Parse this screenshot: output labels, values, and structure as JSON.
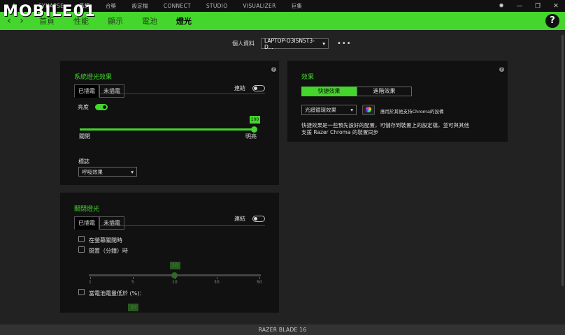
{
  "watermark": "MOBILE01",
  "topnav": [
    "SYNAPSE",
    "系統",
    "合獎",
    "設定檔",
    "CONNECT",
    "STUDIO",
    "VISUALIZER",
    "巨集"
  ],
  "subnav": [
    "首頁",
    "性能",
    "顯示",
    "電池",
    "燈光"
  ],
  "profile": {
    "label": "個人資料",
    "value": "LAPTOP-O3ISN5T3-D..."
  },
  "system_lighting": {
    "title": "系統燈光效果",
    "tabs": [
      "已插電",
      "未插電"
    ],
    "sync_label": "連結",
    "brightness_label": "亮度",
    "brightness_value": 100,
    "min_label": "關閉",
    "max_label": "明亮",
    "logo_label": "標誌",
    "logo_effect": "呼吸效果"
  },
  "lighting_off": {
    "title": "關閉燈光",
    "tabs": [
      "已插電",
      "未插電"
    ],
    "sync_label": "連結",
    "option_screen_off": "在螢幕關閉時",
    "option_idle": "閒置（分鐘）時",
    "idle_value": "10",
    "idle_ticks": [
      "1",
      "5",
      "10",
      "30",
      "50"
    ],
    "option_battery": "當電池電量低於 (%)：",
    "battery_value": "30"
  },
  "effects": {
    "title": "效果",
    "segments": [
      "快捷效果",
      "進階效果"
    ],
    "effect_select": "光譜循環效果",
    "apply_chroma": "應用於其他支持Chroma的設備",
    "desc_line1": "快捷效果是一些預先設好的配置，可儲存到裝置上的設定檔，並可與其他",
    "desc_line2": "支援 Razer Chroma 的裝置同步"
  },
  "device_name": "RAZER BLADE 16"
}
